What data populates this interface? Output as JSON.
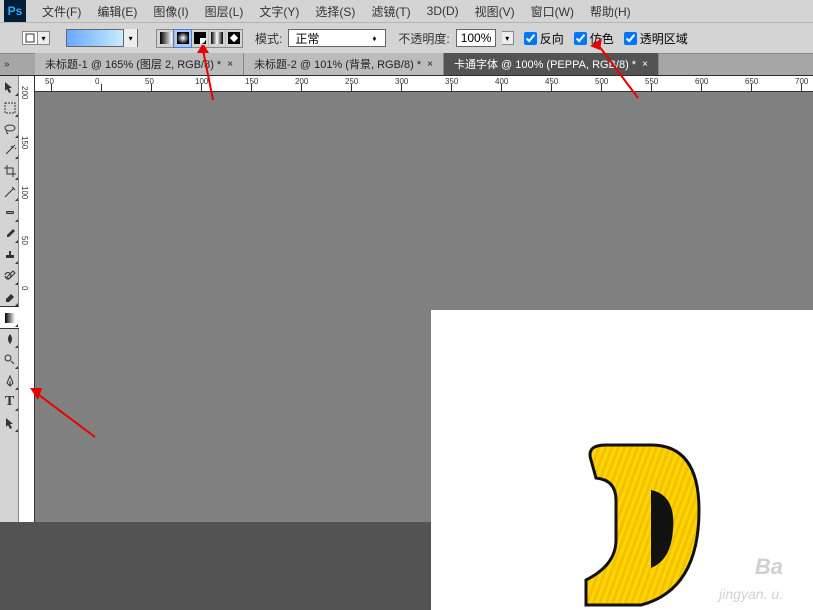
{
  "app_logo": "Ps",
  "menu": [
    "文件(F)",
    "编辑(E)",
    "图像(I)",
    "图层(L)",
    "文字(Y)",
    "选择(S)",
    "滤镜(T)",
    "3D(D)",
    "视图(V)",
    "窗口(W)",
    "帮助(H)"
  ],
  "optbar": {
    "mode_label": "模式:",
    "mode_value": "正常",
    "opacity_label": "不透明度:",
    "opacity_value": "100%",
    "reverse": "反向",
    "dither": "仿色",
    "transparency": "透明区域"
  },
  "tabs": [
    {
      "label": "未标题-1 @ 165% (图层 2, RGB/8) *",
      "active": false
    },
    {
      "label": "未标题-2 @ 101% (背景, RGB/8) *",
      "active": false
    },
    {
      "label": "卡通字体 @ 100% (PEPPA, RGB/8) *",
      "active": true
    }
  ],
  "ruler_h": [
    "50",
    "0",
    "50",
    "100",
    "150",
    "200",
    "250",
    "300",
    "350",
    "400",
    "450",
    "500",
    "550",
    "600",
    "650",
    "700",
    "350"
  ],
  "ruler_v": [
    "200",
    "150",
    "100",
    "50",
    "0"
  ],
  "ruler_h_positions": [
    10,
    60,
    110,
    160,
    210,
    260,
    310,
    360,
    410,
    460,
    510,
    560,
    610,
    660,
    710,
    760
  ],
  "ruler_v_positions": [
    10,
    60,
    110,
    160,
    210,
    260,
    310,
    360,
    410
  ],
  "watermark": "Ba",
  "watermark2": "jingyan.    u."
}
